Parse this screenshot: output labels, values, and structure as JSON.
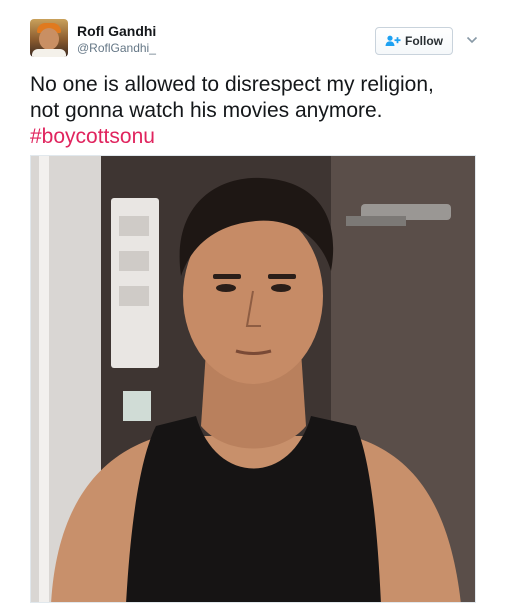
{
  "tweet": {
    "author": {
      "display_name": "Rofl Gandhi",
      "handle": "@RoflGandhi_",
      "avatar_icon": "avatar-photo"
    },
    "follow_button": {
      "label": "Follow",
      "icon": "add-user-icon"
    },
    "more_icon": "chevron-down-icon",
    "text_line_1": "No one is allowed to disrespect my religion,",
    "text_line_2": "not gonna watch his movies anymore.",
    "hashtag": "#boycottsonu",
    "colors": {
      "hashtag": "#e0245e",
      "text": "#14171a",
      "handle": "#657786"
    },
    "media": {
      "type": "photo",
      "subject": "man-in-black-tank-top"
    }
  }
}
